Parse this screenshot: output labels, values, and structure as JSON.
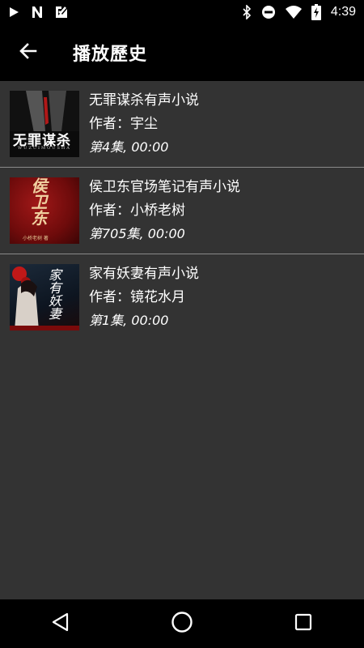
{
  "status_bar": {
    "time": "4:39",
    "icons": [
      "play-icon",
      "n-notification-icon",
      "check-notification-icon",
      "bluetooth-icon",
      "do-not-disturb-icon",
      "wifi-icon",
      "battery-charging-icon"
    ]
  },
  "app_bar": {
    "back_icon": "arrow-back-icon",
    "title": "播放歷史"
  },
  "history": [
    {
      "title": "无罪谋杀有声小说",
      "author": "作者：宇尘",
      "episode": "第4集, 00:00",
      "cover_text": "无罪谋杀",
      "cover_subtext": "WUZUIMOUSHA"
    },
    {
      "title": "侯卫东官场笔记有声小说",
      "author": "作者：小桥老树",
      "episode": "第705集, 00:00",
      "cover_text": "侯卫东",
      "cover_subtext": "小桥老树 著"
    },
    {
      "title": "家有妖妻有声小说",
      "author": "作者：镜花水月",
      "episode": "第1集, 00:00",
      "cover_text": "家有妖妻",
      "cover_subtext": ""
    }
  ],
  "nav_bar": {
    "icons": [
      "back-triangle-icon",
      "home-circle-icon",
      "recents-square-icon"
    ]
  }
}
